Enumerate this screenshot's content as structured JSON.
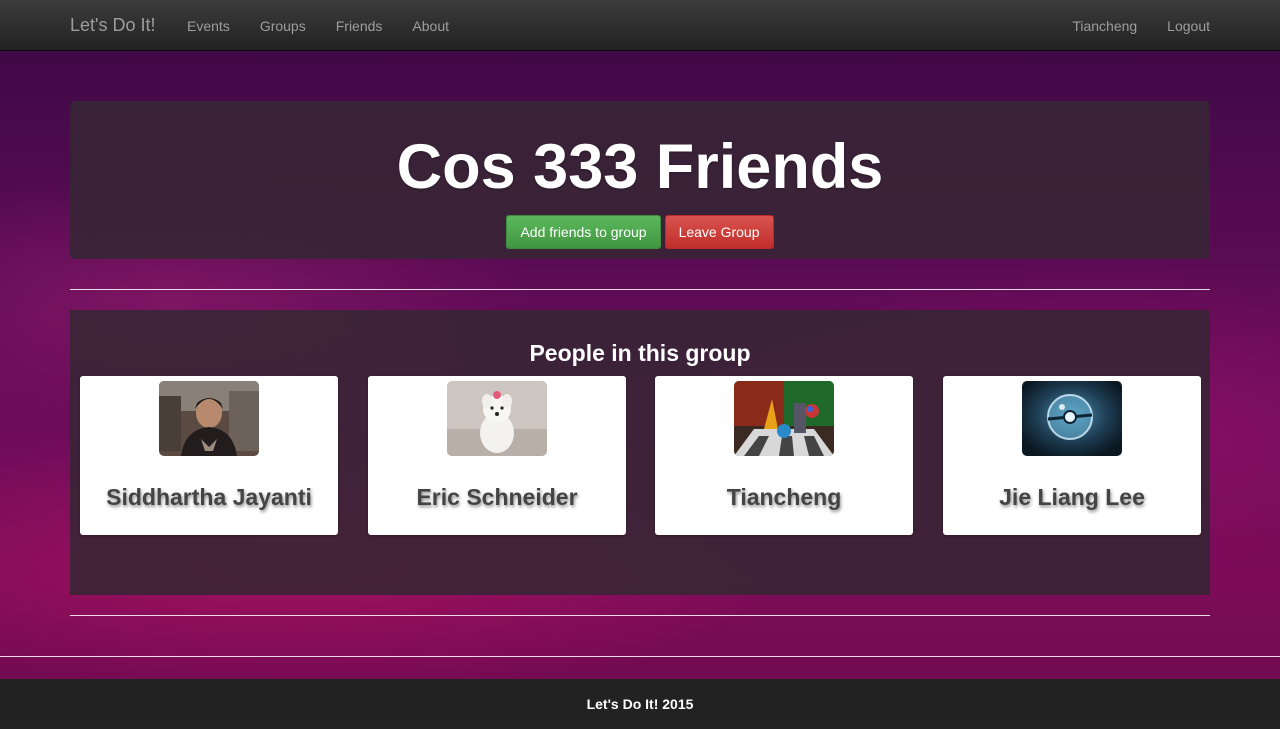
{
  "navbar": {
    "brand": "Let's Do It!",
    "left_links": [
      "Events",
      "Groups",
      "Friends",
      "About"
    ],
    "right_links": [
      "Tiancheng",
      "Logout"
    ]
  },
  "group": {
    "title": "Cos 333 Friends",
    "add_button": "Add friends to group",
    "leave_button": "Leave Group"
  },
  "people_section": {
    "heading": "People in this group",
    "members": [
      {
        "name": "Siddhartha Jayanti",
        "avatar": "photo-person"
      },
      {
        "name": "Eric Schneider",
        "avatar": "photo-white-dog"
      },
      {
        "name": "Tiancheng",
        "avatar": "photo-3d-render"
      },
      {
        "name": "Jie Liang Lee",
        "avatar": "photo-pokeball"
      }
    ]
  },
  "footer": {
    "text": "Let's Do It! 2015"
  },
  "colors": {
    "success": "#5cb85c",
    "danger": "#d9534f",
    "navbar": "#222222"
  }
}
